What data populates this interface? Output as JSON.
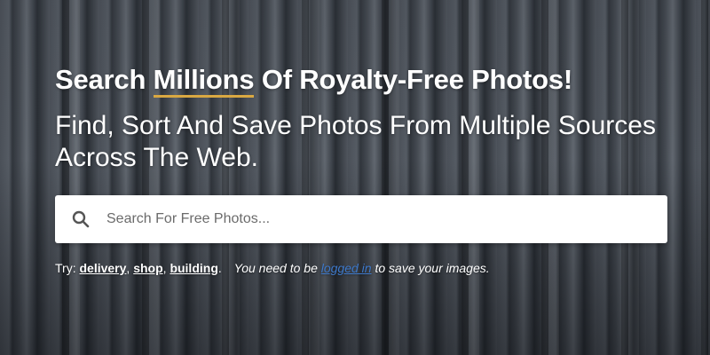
{
  "hero": {
    "headline_before": "Search ",
    "headline_highlight": "Millions",
    "headline_after": " Of Royalty-Free Photos!",
    "subheadline": "Find, Sort And Save Photos From Multiple Sources Across The Web.",
    "accent_color": "#d9a842"
  },
  "search": {
    "placeholder": "Search For Free Photos...",
    "value": "",
    "icon": "search-icon"
  },
  "suggestions": {
    "label": "Try:",
    "items": [
      "delivery",
      "shop",
      "building"
    ],
    "separator": ",",
    "end": "."
  },
  "notice": {
    "before": "You need to be ",
    "link": "logged in",
    "after": " to save your images.",
    "link_color": "#3d78c9"
  }
}
